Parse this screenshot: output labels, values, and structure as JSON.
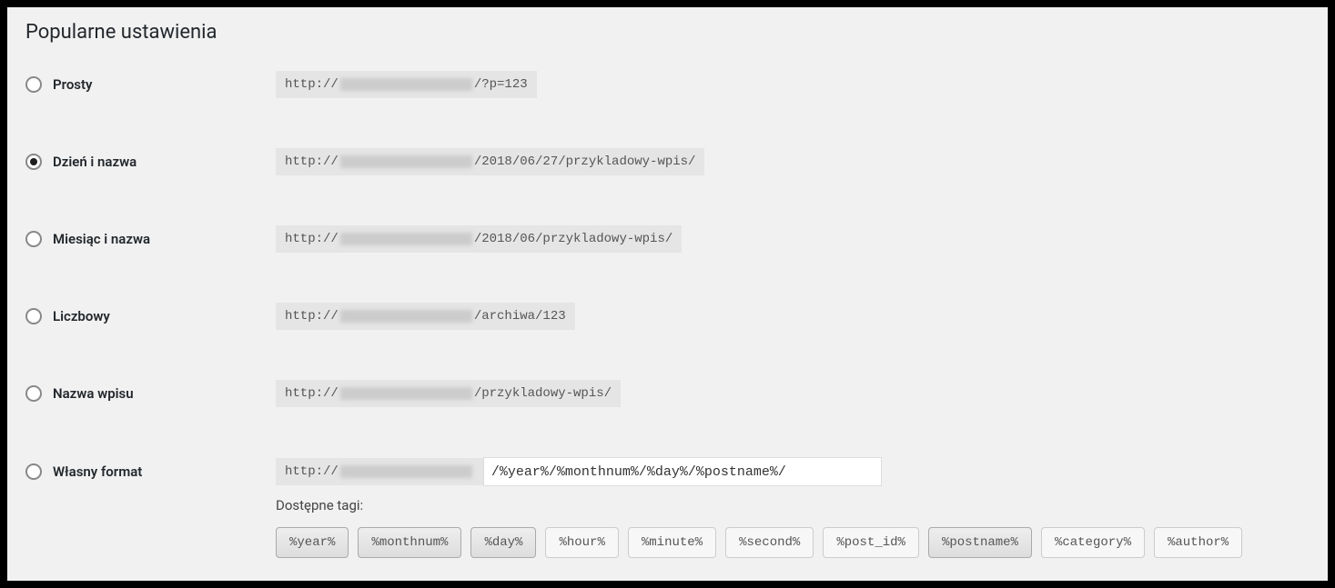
{
  "heading": "Popularne ustawienia",
  "options": [
    {
      "label": "Prosty",
      "checked": false,
      "url_prefix": "http://",
      "url_suffix": "/?p=123"
    },
    {
      "label": "Dzień i nazwa",
      "checked": true,
      "url_prefix": "http://",
      "url_suffix": "/2018/06/27/przykladowy-wpis/"
    },
    {
      "label": "Miesiąc i nazwa",
      "checked": false,
      "url_prefix": "http://",
      "url_suffix": "/2018/06/przykladowy-wpis/"
    },
    {
      "label": "Liczbowy",
      "checked": false,
      "url_prefix": "http://",
      "url_suffix": "/archiwa/123"
    },
    {
      "label": "Nazwa wpisu",
      "checked": false,
      "url_prefix": "http://",
      "url_suffix": "/przykladowy-wpis/"
    }
  ],
  "custom": {
    "label": "Własny format",
    "checked": false,
    "url_prefix": "http://",
    "input_value": "/%year%/%monthnum%/%day%/%postname%/"
  },
  "tags_label": "Dostępne tagi:",
  "tags": [
    {
      "text": "%year%",
      "active": true
    },
    {
      "text": "%monthnum%",
      "active": true
    },
    {
      "text": "%day%",
      "active": true
    },
    {
      "text": "%hour%",
      "active": false
    },
    {
      "text": "%minute%",
      "active": false
    },
    {
      "text": "%second%",
      "active": false
    },
    {
      "text": "%post_id%",
      "active": false
    },
    {
      "text": "%postname%",
      "active": true
    },
    {
      "text": "%category%",
      "active": false
    },
    {
      "text": "%author%",
      "active": false
    }
  ]
}
